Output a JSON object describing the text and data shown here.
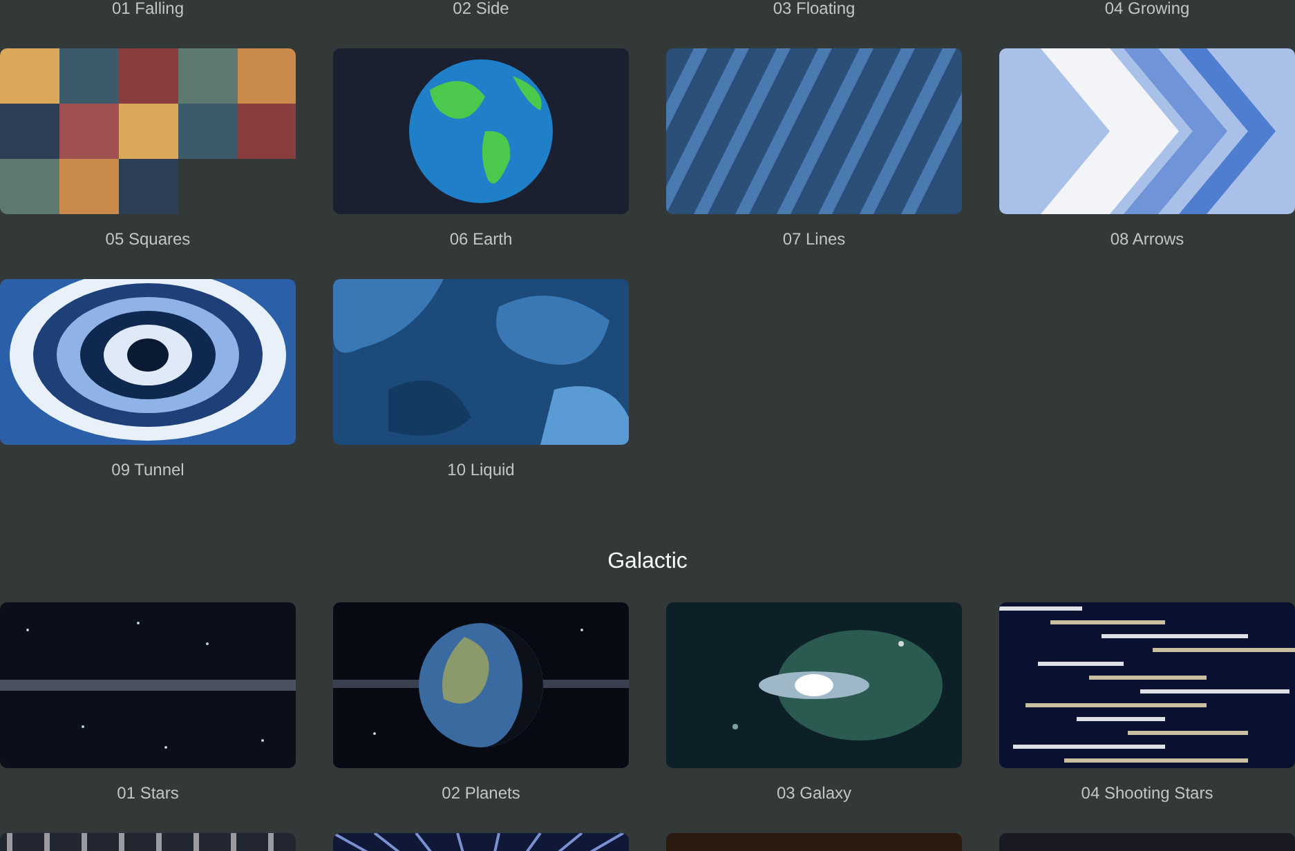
{
  "sections": [
    {
      "items": [
        {
          "kind": "caption",
          "label": "01 Falling"
        },
        {
          "kind": "caption",
          "label": "02 Side"
        },
        {
          "kind": "caption",
          "label": "03 Floating"
        },
        {
          "kind": "caption",
          "label": "04 Growing"
        },
        {
          "kind": "picture",
          "label": "05 Squares"
        },
        {
          "kind": "picture",
          "label": "06 Earth"
        },
        {
          "kind": "picture",
          "label": "07 Lines"
        },
        {
          "kind": "picture",
          "label": "08 Arrows"
        },
        {
          "kind": "picture",
          "label": "09 Tunnel"
        },
        {
          "kind": "picture",
          "label": "10 Liquid"
        }
      ]
    },
    {
      "title": "Galactic",
      "items": [
        {
          "kind": "picture",
          "label": "01 Stars"
        },
        {
          "kind": "picture",
          "label": "02 Planets"
        },
        {
          "kind": "picture",
          "label": "03 Galaxy"
        },
        {
          "kind": "picture",
          "label": "04 Shooting Stars"
        },
        {
          "kind": "picture"
        },
        {
          "kind": "picture"
        },
        {
          "kind": "picture"
        },
        {
          "kind": "picture"
        }
      ]
    }
  ]
}
